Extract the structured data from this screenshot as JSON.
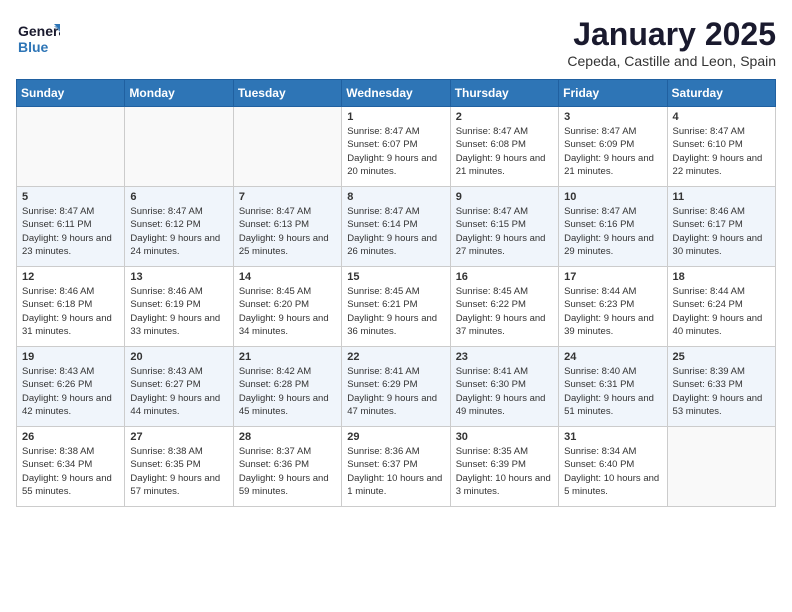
{
  "header": {
    "logo_general": "General",
    "logo_blue": "Blue",
    "month_title": "January 2025",
    "subtitle": "Cepeda, Castille and Leon, Spain"
  },
  "weekdays": [
    "Sunday",
    "Monday",
    "Tuesday",
    "Wednesday",
    "Thursday",
    "Friday",
    "Saturday"
  ],
  "weeks": [
    [
      {
        "day": "",
        "sunrise": "",
        "sunset": "",
        "daylight": ""
      },
      {
        "day": "",
        "sunrise": "",
        "sunset": "",
        "daylight": ""
      },
      {
        "day": "",
        "sunrise": "",
        "sunset": "",
        "daylight": ""
      },
      {
        "day": "1",
        "sunrise": "Sunrise: 8:47 AM",
        "sunset": "Sunset: 6:07 PM",
        "daylight": "Daylight: 9 hours and 20 minutes."
      },
      {
        "day": "2",
        "sunrise": "Sunrise: 8:47 AM",
        "sunset": "Sunset: 6:08 PM",
        "daylight": "Daylight: 9 hours and 21 minutes."
      },
      {
        "day": "3",
        "sunrise": "Sunrise: 8:47 AM",
        "sunset": "Sunset: 6:09 PM",
        "daylight": "Daylight: 9 hours and 21 minutes."
      },
      {
        "day": "4",
        "sunrise": "Sunrise: 8:47 AM",
        "sunset": "Sunset: 6:10 PM",
        "daylight": "Daylight: 9 hours and 22 minutes."
      }
    ],
    [
      {
        "day": "5",
        "sunrise": "Sunrise: 8:47 AM",
        "sunset": "Sunset: 6:11 PM",
        "daylight": "Daylight: 9 hours and 23 minutes."
      },
      {
        "day": "6",
        "sunrise": "Sunrise: 8:47 AM",
        "sunset": "Sunset: 6:12 PM",
        "daylight": "Daylight: 9 hours and 24 minutes."
      },
      {
        "day": "7",
        "sunrise": "Sunrise: 8:47 AM",
        "sunset": "Sunset: 6:13 PM",
        "daylight": "Daylight: 9 hours and 25 minutes."
      },
      {
        "day": "8",
        "sunrise": "Sunrise: 8:47 AM",
        "sunset": "Sunset: 6:14 PM",
        "daylight": "Daylight: 9 hours and 26 minutes."
      },
      {
        "day": "9",
        "sunrise": "Sunrise: 8:47 AM",
        "sunset": "Sunset: 6:15 PM",
        "daylight": "Daylight: 9 hours and 27 minutes."
      },
      {
        "day": "10",
        "sunrise": "Sunrise: 8:47 AM",
        "sunset": "Sunset: 6:16 PM",
        "daylight": "Daylight: 9 hours and 29 minutes."
      },
      {
        "day": "11",
        "sunrise": "Sunrise: 8:46 AM",
        "sunset": "Sunset: 6:17 PM",
        "daylight": "Daylight: 9 hours and 30 minutes."
      }
    ],
    [
      {
        "day": "12",
        "sunrise": "Sunrise: 8:46 AM",
        "sunset": "Sunset: 6:18 PM",
        "daylight": "Daylight: 9 hours and 31 minutes."
      },
      {
        "day": "13",
        "sunrise": "Sunrise: 8:46 AM",
        "sunset": "Sunset: 6:19 PM",
        "daylight": "Daylight: 9 hours and 33 minutes."
      },
      {
        "day": "14",
        "sunrise": "Sunrise: 8:45 AM",
        "sunset": "Sunset: 6:20 PM",
        "daylight": "Daylight: 9 hours and 34 minutes."
      },
      {
        "day": "15",
        "sunrise": "Sunrise: 8:45 AM",
        "sunset": "Sunset: 6:21 PM",
        "daylight": "Daylight: 9 hours and 36 minutes."
      },
      {
        "day": "16",
        "sunrise": "Sunrise: 8:45 AM",
        "sunset": "Sunset: 6:22 PM",
        "daylight": "Daylight: 9 hours and 37 minutes."
      },
      {
        "day": "17",
        "sunrise": "Sunrise: 8:44 AM",
        "sunset": "Sunset: 6:23 PM",
        "daylight": "Daylight: 9 hours and 39 minutes."
      },
      {
        "day": "18",
        "sunrise": "Sunrise: 8:44 AM",
        "sunset": "Sunset: 6:24 PM",
        "daylight": "Daylight: 9 hours and 40 minutes."
      }
    ],
    [
      {
        "day": "19",
        "sunrise": "Sunrise: 8:43 AM",
        "sunset": "Sunset: 6:26 PM",
        "daylight": "Daylight: 9 hours and 42 minutes."
      },
      {
        "day": "20",
        "sunrise": "Sunrise: 8:43 AM",
        "sunset": "Sunset: 6:27 PM",
        "daylight": "Daylight: 9 hours and 44 minutes."
      },
      {
        "day": "21",
        "sunrise": "Sunrise: 8:42 AM",
        "sunset": "Sunset: 6:28 PM",
        "daylight": "Daylight: 9 hours and 45 minutes."
      },
      {
        "day": "22",
        "sunrise": "Sunrise: 8:41 AM",
        "sunset": "Sunset: 6:29 PM",
        "daylight": "Daylight: 9 hours and 47 minutes."
      },
      {
        "day": "23",
        "sunrise": "Sunrise: 8:41 AM",
        "sunset": "Sunset: 6:30 PM",
        "daylight": "Daylight: 9 hours and 49 minutes."
      },
      {
        "day": "24",
        "sunrise": "Sunrise: 8:40 AM",
        "sunset": "Sunset: 6:31 PM",
        "daylight": "Daylight: 9 hours and 51 minutes."
      },
      {
        "day": "25",
        "sunrise": "Sunrise: 8:39 AM",
        "sunset": "Sunset: 6:33 PM",
        "daylight": "Daylight: 9 hours and 53 minutes."
      }
    ],
    [
      {
        "day": "26",
        "sunrise": "Sunrise: 8:38 AM",
        "sunset": "Sunset: 6:34 PM",
        "daylight": "Daylight: 9 hours and 55 minutes."
      },
      {
        "day": "27",
        "sunrise": "Sunrise: 8:38 AM",
        "sunset": "Sunset: 6:35 PM",
        "daylight": "Daylight: 9 hours and 57 minutes."
      },
      {
        "day": "28",
        "sunrise": "Sunrise: 8:37 AM",
        "sunset": "Sunset: 6:36 PM",
        "daylight": "Daylight: 9 hours and 59 minutes."
      },
      {
        "day": "29",
        "sunrise": "Sunrise: 8:36 AM",
        "sunset": "Sunset: 6:37 PM",
        "daylight": "Daylight: 10 hours and 1 minute."
      },
      {
        "day": "30",
        "sunrise": "Sunrise: 8:35 AM",
        "sunset": "Sunset: 6:39 PM",
        "daylight": "Daylight: 10 hours and 3 minutes."
      },
      {
        "day": "31",
        "sunrise": "Sunrise: 8:34 AM",
        "sunset": "Sunset: 6:40 PM",
        "daylight": "Daylight: 10 hours and 5 minutes."
      },
      {
        "day": "",
        "sunrise": "",
        "sunset": "",
        "daylight": ""
      }
    ]
  ]
}
